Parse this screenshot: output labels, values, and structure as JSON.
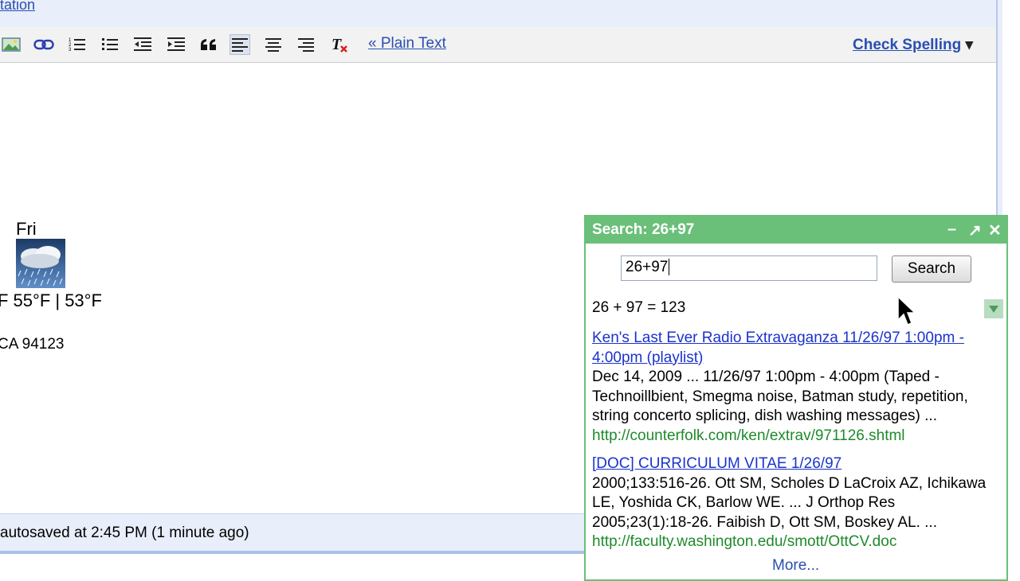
{
  "header": {
    "top_link": "tation"
  },
  "toolbar": {
    "buttons": [
      {
        "name": "insert-image",
        "icon": "image-icon"
      },
      {
        "name": "link",
        "icon": "link-icon"
      },
      {
        "name": "numbered-list",
        "icon": "numbered-list-icon"
      },
      {
        "name": "bulleted-list",
        "icon": "bulleted-list-icon"
      },
      {
        "name": "indent-less",
        "icon": "outdent-icon"
      },
      {
        "name": "indent-more",
        "icon": "indent-icon"
      },
      {
        "name": "quote",
        "icon": "quote-icon"
      },
      {
        "name": "align-left",
        "icon": "align-left-icon",
        "active": true
      },
      {
        "name": "align-center",
        "icon": "align-center-icon"
      },
      {
        "name": "align-right",
        "icon": "align-right-icon"
      },
      {
        "name": "remove-formatting",
        "icon": "remove-formatting-icon"
      }
    ],
    "plain_text": "« Plain Text",
    "check_spelling": "Check Spelling",
    "check_spelling_arrow": "▾"
  },
  "editor": {
    "weather": {
      "day": "Fri",
      "temps": "F 55°F | 53°F",
      "location": "CA 94123",
      "icon": "rain-cloud-icon"
    }
  },
  "status": {
    "text": "autosaved at 2:45 PM (1 minute ago)"
  },
  "search_panel": {
    "title": "Search: 26+97",
    "controls": {
      "minimize": "–",
      "popout": "↗",
      "close": "✕"
    },
    "query": "26+97",
    "button": "Search",
    "calculation": "26 + 97 = 123",
    "results": [
      {
        "title": "Ken's Last Ever Radio Extravaganza 11/26/97 1:00pm - 4:00pm (playlist)",
        "snippet": "Dec 14, 2009 ... 11/26/97 1:00pm - 4:00pm (Taped - Technoillbient, Smegma noise, Batman study, repetition, string concerto splicing, dish washing messages) ...",
        "url": "http://counterfolk.com/ken/extrav/971126.shtml"
      },
      {
        "title": "[DOC] CURRICULUM VITAE 1/26/97",
        "snippet": "2000;133:516-26. Ott SM, Scholes D LaCroix AZ, Ichikawa LE, Yoshida CK, Barlow WE. ... J Orthop Res 2005;23(1):18-26. Faibish D, Ott SM, Boskey AL. ...",
        "url": "http://faculty.washington.edu/smott/OttCV.doc"
      }
    ],
    "more": "More..."
  },
  "colors": {
    "panel_green": "#6abf79",
    "link_blue": "#1a33cc",
    "url_green": "#1e8a2b",
    "chrome_blue": "#e8eefa"
  }
}
